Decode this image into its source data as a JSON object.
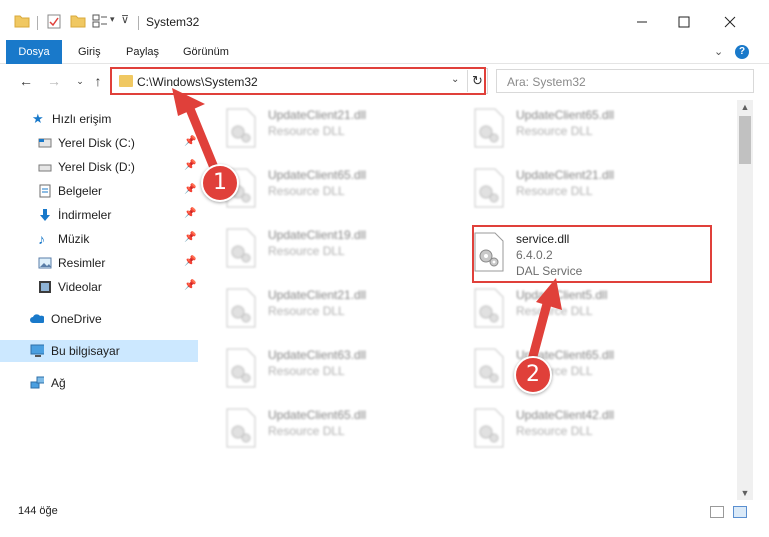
{
  "window": {
    "title": "System32",
    "help_icon": "?"
  },
  "ribbon": {
    "tabs": [
      "Dosya",
      "Giriş",
      "Paylaş",
      "Görünüm"
    ]
  },
  "address": {
    "path": "C:\\Windows\\System32",
    "search_placeholder": "Ara: System32"
  },
  "sidebar": {
    "quick_access": "Hızlı erişim",
    "items": [
      {
        "label": "Yerel Disk (C:)",
        "icon": "drive-icon",
        "pinned": true
      },
      {
        "label": "Yerel Disk (D:)",
        "icon": "drive-icon",
        "pinned": true
      },
      {
        "label": "Belgeler",
        "icon": "documents-icon",
        "pinned": true
      },
      {
        "label": "İndirmeler",
        "icon": "downloads-icon",
        "pinned": true
      },
      {
        "label": "Müzik",
        "icon": "music-icon",
        "pinned": true
      },
      {
        "label": "Resimler",
        "icon": "pictures-icon",
        "pinned": true
      },
      {
        "label": "Videolar",
        "icon": "videos-icon",
        "pinned": true
      }
    ],
    "onedrive": "OneDrive",
    "this_pc": "Bu bilgisayar",
    "network": "Ağ"
  },
  "files": {
    "left_column": [
      {
        "name": "UpdateClient21.dll",
        "desc": "Resource DLL"
      },
      {
        "name": "UpdateClient65.dll",
        "desc": "Resource DLL"
      },
      {
        "name": "UpdateClient19.dll",
        "desc": "Resource DLL"
      },
      {
        "name": "UpdateClient21.dll",
        "desc": "Resource DLL"
      },
      {
        "name": "UpdateClient63.dll",
        "desc": "Resource DLL"
      },
      {
        "name": "UpdateClient65.dll",
        "desc": "Resource DLL"
      }
    ],
    "right_column": [
      {
        "name": "UpdateClient65.dll",
        "desc": "Resource DLL"
      },
      {
        "name": "UpdateClient21.dll",
        "desc": "Resource DLL"
      },
      {
        "name": "service.dll",
        "desc": "6.4.0.2",
        "desc2": "DAL Service",
        "highlighted": true
      },
      {
        "name": "UpdateClient5.dll",
        "desc": "Resource DLL"
      },
      {
        "name": "UpdateClient65.dll",
        "desc": "Resource DLL"
      },
      {
        "name": "UpdateClient42.dll",
        "desc": "Resource DLL"
      }
    ]
  },
  "status": {
    "item_count": "144 öğe"
  },
  "annotations": {
    "step1": "1",
    "step2": "2",
    "accent_color": "#e0403a"
  },
  "colors": {
    "file_tab": "#1979ca",
    "selected_nav": "#cce8ff"
  }
}
